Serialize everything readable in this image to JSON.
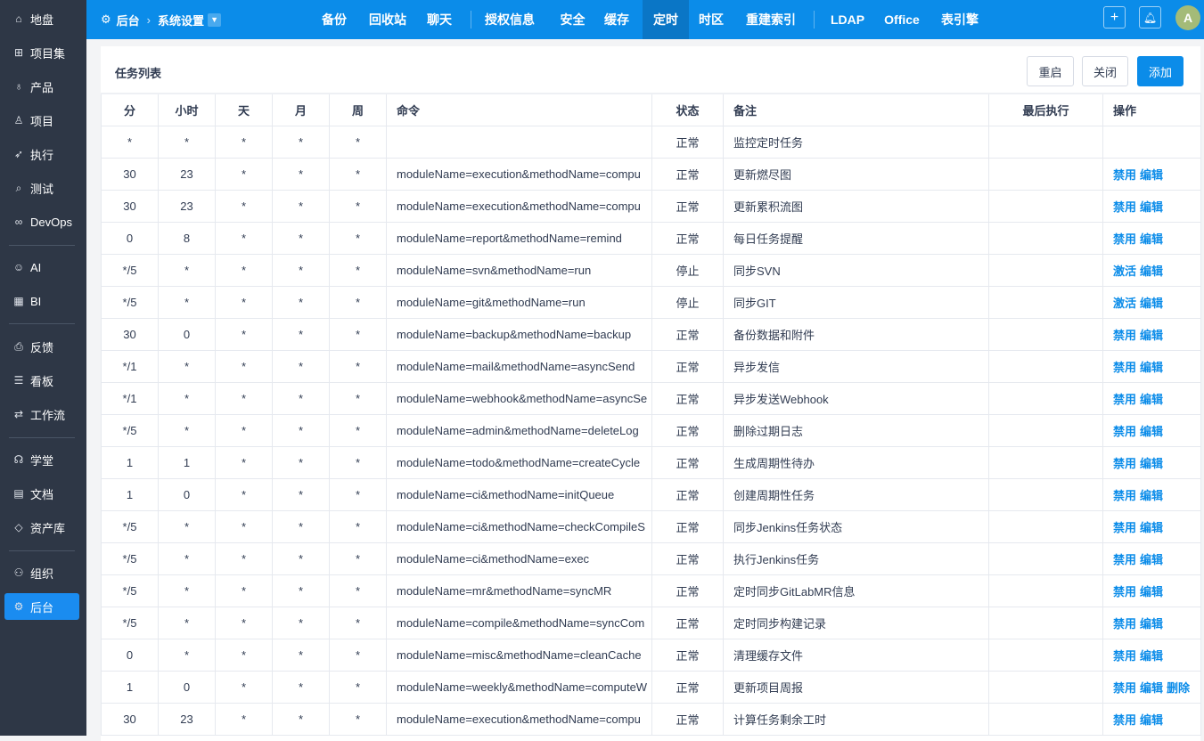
{
  "sidebar": {
    "items": [
      "地盘",
      "项目集",
      "产品",
      "项目",
      "执行",
      "测试",
      "DevOps",
      "AI",
      "BI",
      "反馈",
      "看板",
      "工作流",
      "学堂",
      "文档",
      "资产库",
      "组织",
      "后台"
    ],
    "active": "后台"
  },
  "topbar": {
    "breadcrumb_root": "后台",
    "breadcrumb_current": "系统设置",
    "nav": [
      "备份",
      "回收站",
      "聊天",
      "授权信息",
      "安全",
      "缓存",
      "定时",
      "时区",
      "重建索引",
      "LDAP",
      "Office",
      "表引擎"
    ],
    "active_nav": "定时",
    "avatar": "A"
  },
  "card": {
    "title": "任务列表",
    "buttons": {
      "restart": "重启",
      "close": "关闭",
      "add": "添加"
    }
  },
  "table": {
    "headers": [
      "分",
      "小时",
      "天",
      "月",
      "周",
      "命令",
      "状态",
      "备注",
      "最后执行",
      "操作"
    ],
    "rows": [
      [
        "*",
        "*",
        "*",
        "*",
        "*",
        "",
        "正常",
        "监控定时任务",
        "",
        []
      ],
      [
        "30",
        "23",
        "*",
        "*",
        "*",
        "moduleName=execution&methodName=compu",
        "正常",
        "更新燃尽图",
        "",
        [
          "禁用",
          "编辑"
        ]
      ],
      [
        "30",
        "23",
        "*",
        "*",
        "*",
        "moduleName=execution&methodName=compu",
        "正常",
        "更新累积流图",
        "",
        [
          "禁用",
          "编辑"
        ]
      ],
      [
        "0",
        "8",
        "*",
        "*",
        "*",
        "moduleName=report&methodName=remind",
        "正常",
        "每日任务提醒",
        "",
        [
          "禁用",
          "编辑"
        ]
      ],
      [
        "*/5",
        "*",
        "*",
        "*",
        "*",
        "moduleName=svn&methodName=run",
        "停止",
        "同步SVN",
        "",
        [
          "激活",
          "编辑"
        ]
      ],
      [
        "*/5",
        "*",
        "*",
        "*",
        "*",
        "moduleName=git&methodName=run",
        "停止",
        "同步GIT",
        "",
        [
          "激活",
          "编辑"
        ]
      ],
      [
        "30",
        "0",
        "*",
        "*",
        "*",
        "moduleName=backup&methodName=backup",
        "正常",
        "备份数据和附件",
        "",
        [
          "禁用",
          "编辑"
        ]
      ],
      [
        "*/1",
        "*",
        "*",
        "*",
        "*",
        "moduleName=mail&methodName=asyncSend",
        "正常",
        "异步发信",
        "",
        [
          "禁用",
          "编辑"
        ]
      ],
      [
        "*/1",
        "*",
        "*",
        "*",
        "*",
        "moduleName=webhook&methodName=asyncSe",
        "正常",
        "异步发送Webhook",
        "",
        [
          "禁用",
          "编辑"
        ]
      ],
      [
        "*/5",
        "*",
        "*",
        "*",
        "*",
        "moduleName=admin&methodName=deleteLog",
        "正常",
        "删除过期日志",
        "",
        [
          "禁用",
          "编辑"
        ]
      ],
      [
        "1",
        "1",
        "*",
        "*",
        "*",
        "moduleName=todo&methodName=createCycle",
        "正常",
        "生成周期性待办",
        "",
        [
          "禁用",
          "编辑"
        ]
      ],
      [
        "1",
        "0",
        "*",
        "*",
        "*",
        "moduleName=ci&methodName=initQueue",
        "正常",
        "创建周期性任务",
        "",
        [
          "禁用",
          "编辑"
        ]
      ],
      [
        "*/5",
        "*",
        "*",
        "*",
        "*",
        "moduleName=ci&methodName=checkCompileS",
        "正常",
        "同步Jenkins任务状态",
        "",
        [
          "禁用",
          "编辑"
        ]
      ],
      [
        "*/5",
        "*",
        "*",
        "*",
        "*",
        "moduleName=ci&methodName=exec",
        "正常",
        "执行Jenkins任务",
        "",
        [
          "禁用",
          "编辑"
        ]
      ],
      [
        "*/5",
        "*",
        "*",
        "*",
        "*",
        "moduleName=mr&methodName=syncMR",
        "正常",
        "定时同步GitLabMR信息",
        "",
        [
          "禁用",
          "编辑"
        ]
      ],
      [
        "*/5",
        "*",
        "*",
        "*",
        "*",
        "moduleName=compile&methodName=syncCom",
        "正常",
        "定时同步构建记录",
        "",
        [
          "禁用",
          "编辑"
        ]
      ],
      [
        "0",
        "*",
        "*",
        "*",
        "*",
        "moduleName=misc&methodName=cleanCache",
        "正常",
        "清理缓存文件",
        "",
        [
          "禁用",
          "编辑"
        ]
      ],
      [
        "1",
        "0",
        "*",
        "*",
        "*",
        "moduleName=weekly&methodName=computeW",
        "正常",
        "更新项目周报",
        "",
        [
          "禁用",
          "编辑",
          "删除"
        ]
      ],
      [
        "30",
        "23",
        "*",
        "*",
        "*",
        "moduleName=execution&methodName=compu",
        "正常",
        "计算任务剩余工时",
        "",
        [
          "禁用",
          "编辑"
        ]
      ]
    ]
  }
}
